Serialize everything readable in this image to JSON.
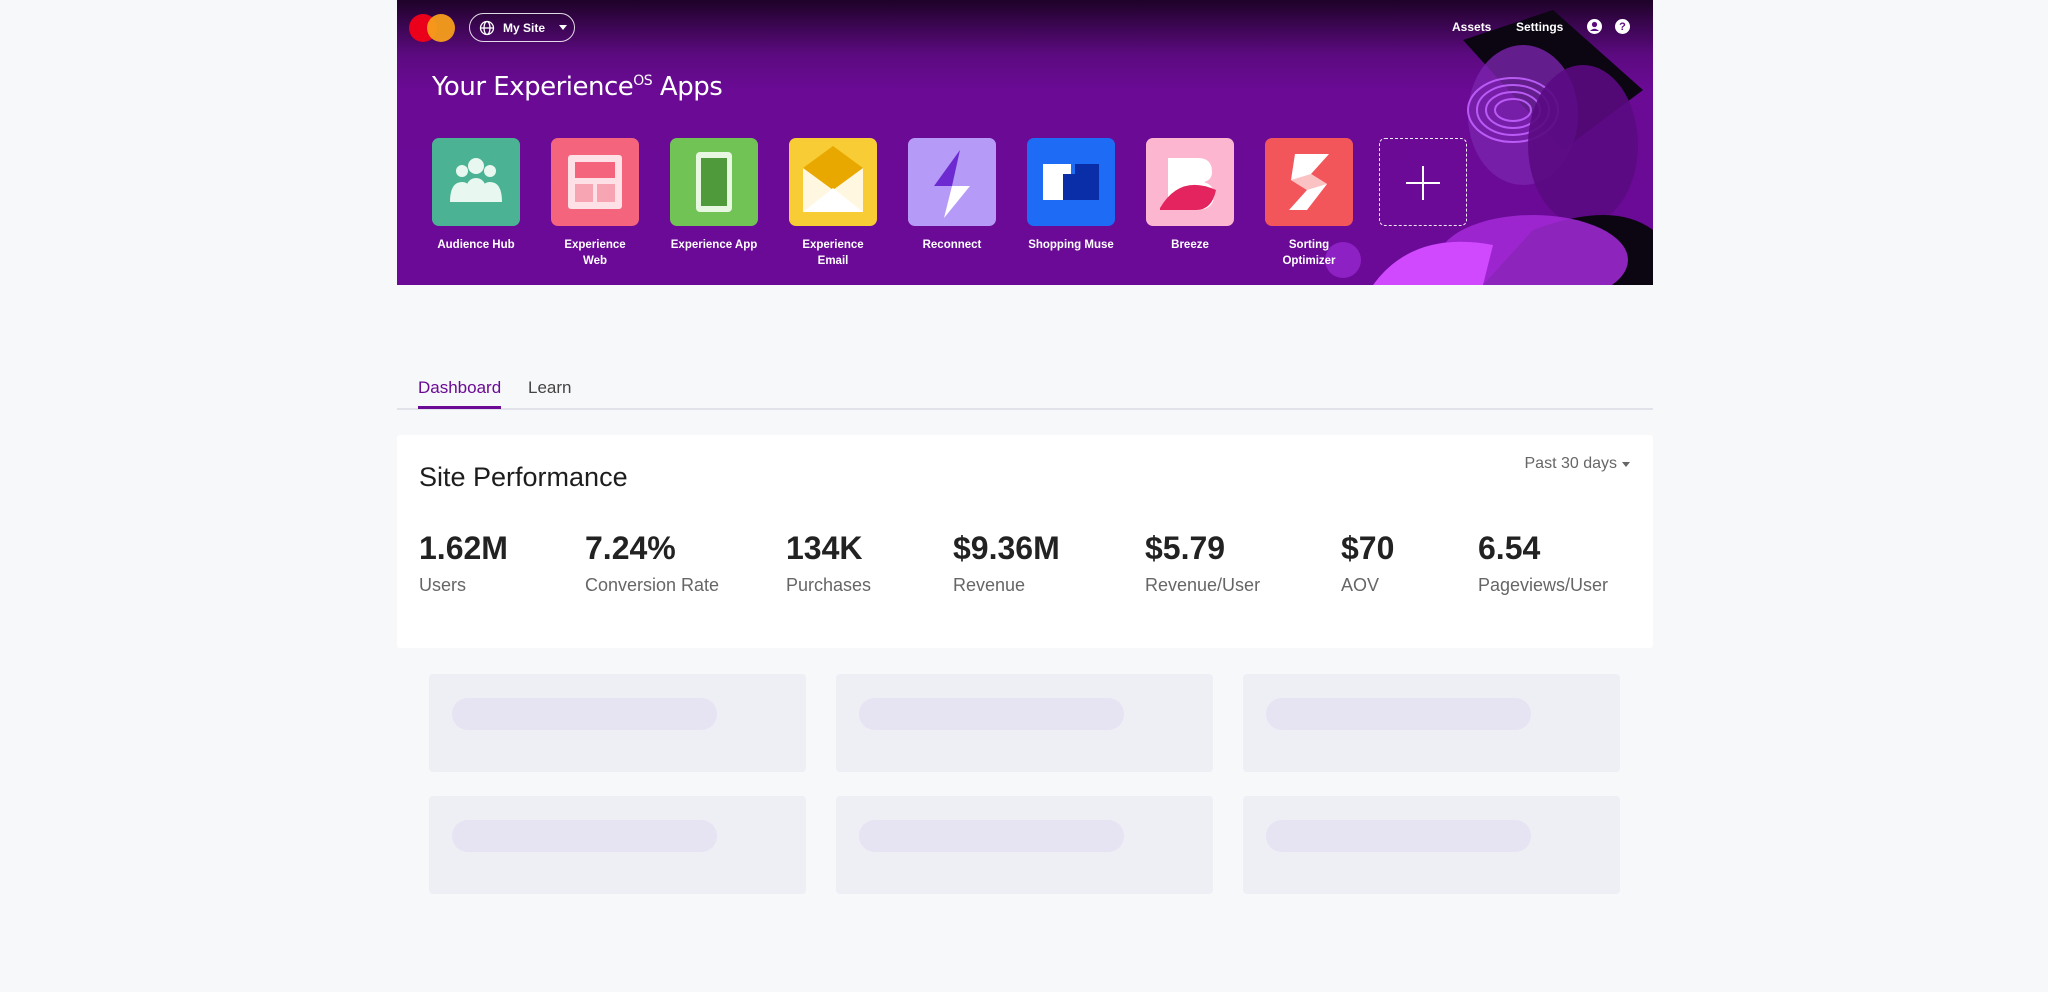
{
  "topbar": {
    "site_selector": "My Site",
    "nav": [
      "Assets",
      "Settings"
    ],
    "icons": [
      "account-icon",
      "help-icon"
    ]
  },
  "hero": {
    "title": "Your Experience",
    "title_sup": "OS",
    "title_suffix": " Apps",
    "apps": [
      {
        "name": "Audience Hub",
        "color": "#4bb393"
      },
      {
        "name": "Experience Web",
        "color": "#f4657d"
      },
      {
        "name": "Experience App",
        "color": "#72c356"
      },
      {
        "name": "Experience Email",
        "color": "#f8cc34"
      },
      {
        "name": "Reconnect",
        "color": "#b59af7"
      },
      {
        "name": "Shopping Muse",
        "color": "#1e6cf5"
      },
      {
        "name": "Breeze",
        "color": "#fcb6cf"
      },
      {
        "name": "Sorting Optimizer",
        "color": "#f2565a"
      }
    ]
  },
  "tabs": {
    "dashboard": "Dashboard",
    "learn": "Learn"
  },
  "performance": {
    "title": "Site Performance",
    "range": "Past 30 days",
    "metrics": [
      {
        "value": "1.62M",
        "label": "Users"
      },
      {
        "value": "7.24%",
        "label": "Conversion Rate"
      },
      {
        "value": "134K",
        "label": "Purchases"
      },
      {
        "value": "$9.36M",
        "label": "Revenue"
      },
      {
        "value": "$5.79",
        "label": "Revenue/User"
      },
      {
        "value": "$70",
        "label": "AOV"
      },
      {
        "value": "6.54",
        "label": "Pageviews/User"
      }
    ]
  },
  "colors": {
    "brand": "#6a0a95",
    "background": "#f7f8fa"
  }
}
